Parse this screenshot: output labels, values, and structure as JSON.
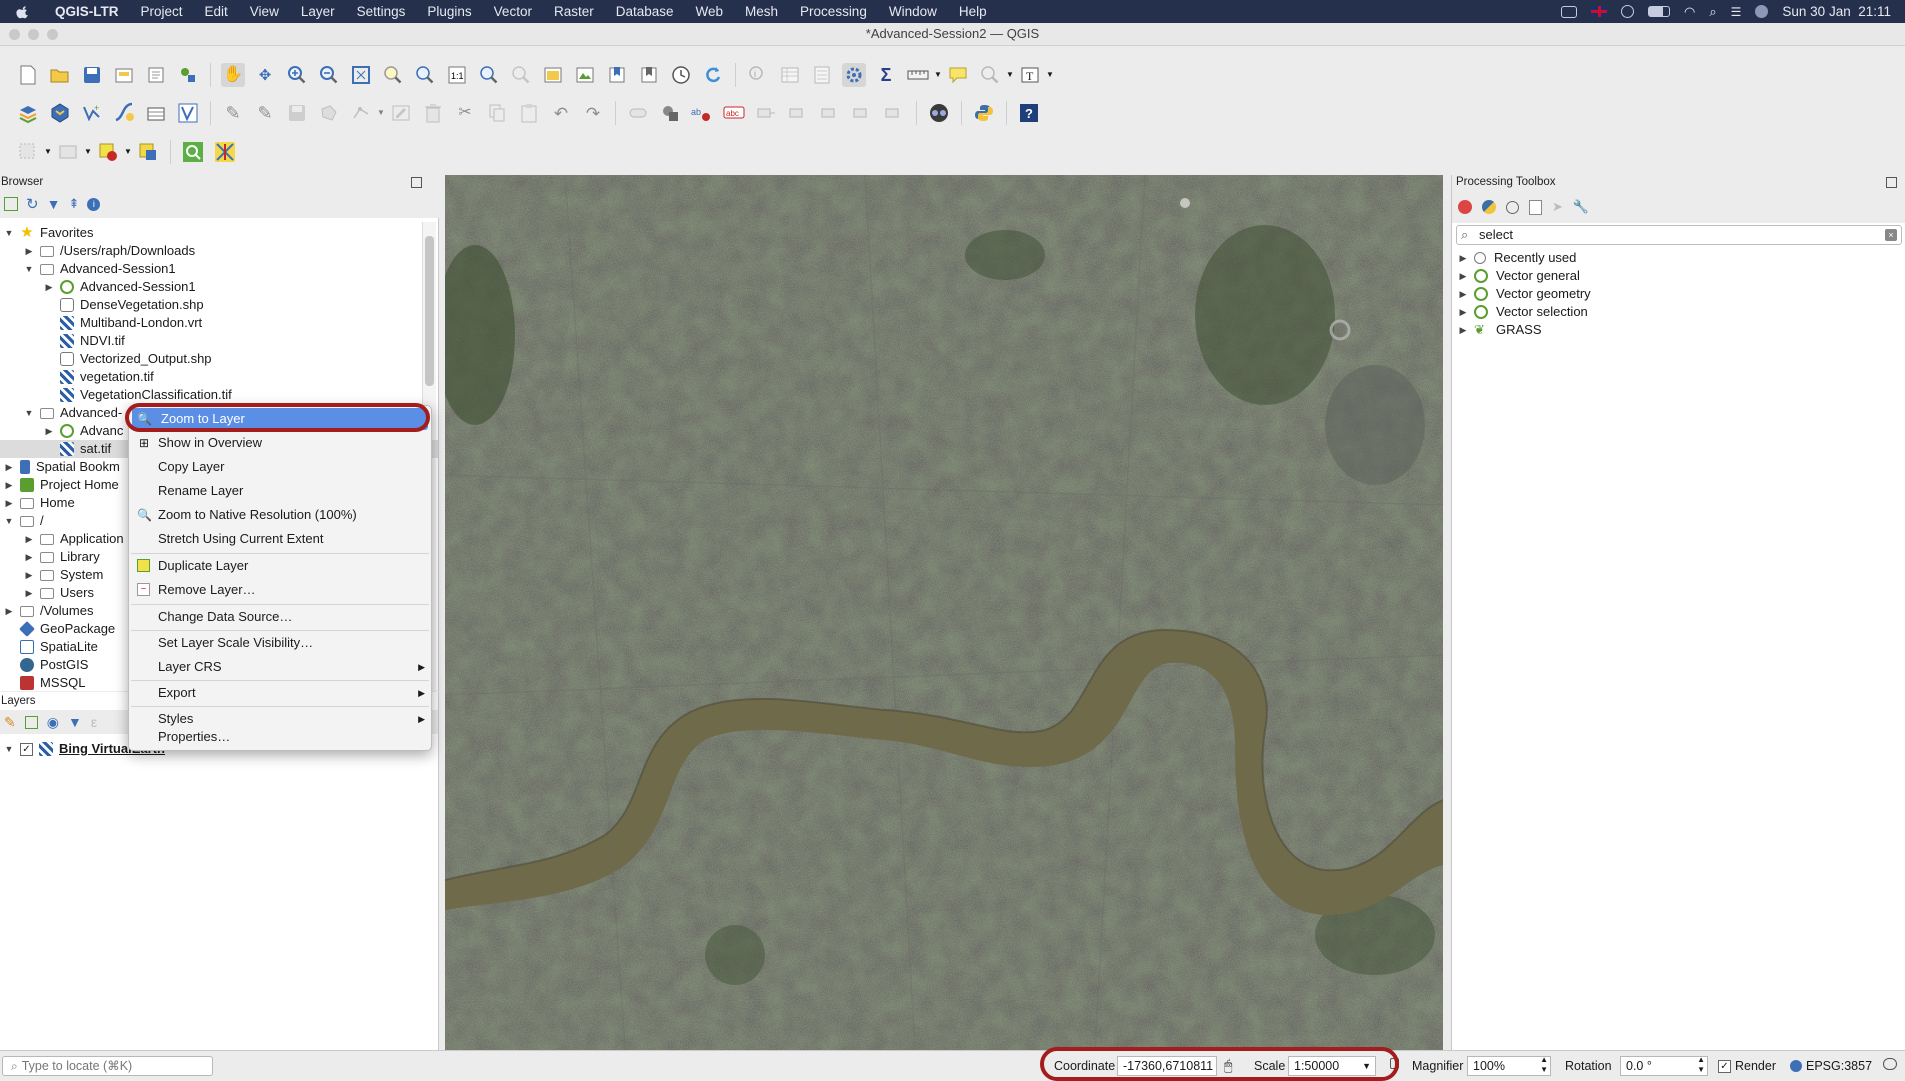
{
  "menubar": {
    "app": "QGIS-LTR",
    "items": [
      "Project",
      "Edit",
      "View",
      "Layer",
      "Settings",
      "Plugins",
      "Vector",
      "Raster",
      "Database",
      "Web",
      "Mesh",
      "Processing",
      "Window",
      "Help"
    ],
    "datetime": "Sun 30 Jan  21:11"
  },
  "window": {
    "title": "*Advanced-Session2 — QGIS"
  },
  "browser": {
    "title": "Browser",
    "items": [
      {
        "label": "Favorites"
      },
      {
        "label": "/Users/raph/Downloads"
      },
      {
        "label": "Advanced-Session1"
      },
      {
        "label": "Advanced-Session1"
      },
      {
        "label": "DenseVegetation.shp"
      },
      {
        "label": "Multiband-London.vrt"
      },
      {
        "label": "NDVI.tif"
      },
      {
        "label": "Vectorized_Output.shp"
      },
      {
        "label": "vegetation.tif"
      },
      {
        "label": "VegetationClassification.tif"
      },
      {
        "label": "Advanced-"
      },
      {
        "label": "Advanc"
      },
      {
        "label": "sat.tif"
      },
      {
        "label": "Spatial Bookm"
      },
      {
        "label": "Project Home"
      },
      {
        "label": "Home"
      },
      {
        "label": "/"
      },
      {
        "label": "Application"
      },
      {
        "label": "Library"
      },
      {
        "label": "System"
      },
      {
        "label": "Users"
      },
      {
        "label": "/Volumes"
      },
      {
        "label": "GeoPackage"
      },
      {
        "label": "SpatiaLite"
      },
      {
        "label": "PostGIS"
      },
      {
        "label": "MSSQL"
      }
    ]
  },
  "layers": {
    "title": "Layers",
    "items": [
      {
        "label": "Bing VirtualEarth",
        "checked": true
      }
    ]
  },
  "context_menu": {
    "items": [
      {
        "label": "Zoom to Layer",
        "highlighted": true
      },
      {
        "label": "Show in Overview"
      },
      {
        "label": "Copy Layer"
      },
      {
        "label": "Rename Layer"
      },
      {
        "label": "Zoom to Native Resolution (100%)"
      },
      {
        "label": "Stretch Using Current Extent"
      },
      {
        "label": "Duplicate Layer"
      },
      {
        "label": "Remove Layer…"
      },
      {
        "label": "Change Data Source…"
      },
      {
        "label": "Set Layer Scale Visibility…"
      },
      {
        "label": "Layer CRS"
      },
      {
        "label": "Export"
      },
      {
        "label": "Styles"
      },
      {
        "label": "Properties…"
      }
    ]
  },
  "toolbox": {
    "title": "Processing Toolbox",
    "search_value": "select",
    "items": [
      {
        "label": "Recently used",
        "icon": "clock-icon"
      },
      {
        "label": "Vector general",
        "icon": "qgis-icon"
      },
      {
        "label": "Vector geometry",
        "icon": "qgis-icon"
      },
      {
        "label": "Vector selection",
        "icon": "qgis-icon"
      },
      {
        "label": "GRASS",
        "icon": "grass-icon"
      }
    ]
  },
  "statusbar": {
    "locate_placeholder": "Type to locate (⌘K)",
    "coordinate_label": "Coordinate",
    "coordinate_value": "-17360,6710811",
    "scale_label": "Scale",
    "scale_value": "1:50000",
    "magnifier_label": "Magnifier",
    "magnifier_value": "100%",
    "rotation_label": "Rotation",
    "rotation_value": "0.0 °",
    "render_label": "Render",
    "crs_label": "EPSG:3857"
  },
  "colors": {
    "menubar": "#25304d",
    "highlight": "#5b8fe6",
    "annotation": "#a31d1d",
    "river": "#6f6a4a"
  }
}
